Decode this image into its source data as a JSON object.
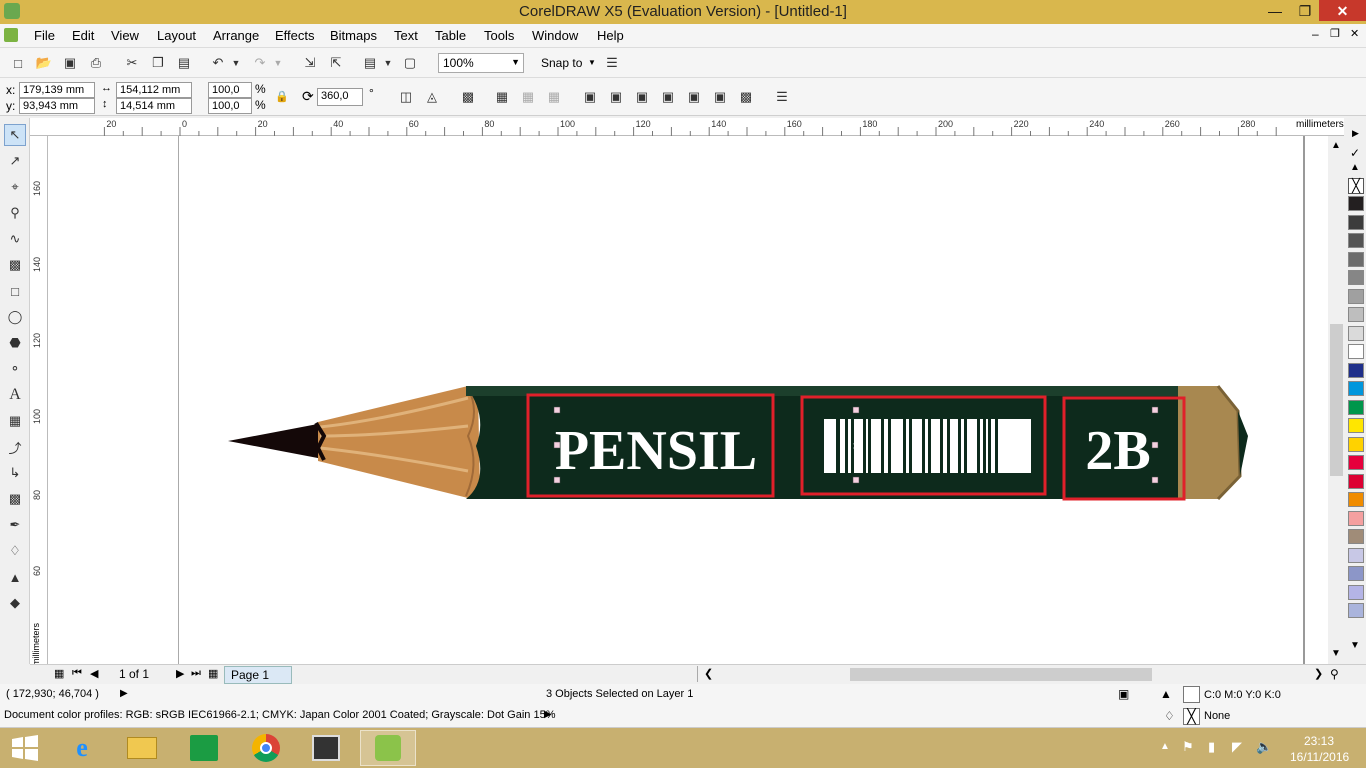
{
  "window": {
    "title": "CorelDRAW X5 (Evaluation Version) - [Untitled-1]",
    "minimize": "—",
    "restore": "❐",
    "close": "✕",
    "doc_minimize": "–",
    "doc_restore": "❐",
    "doc_close": "✕"
  },
  "menu": [
    "File",
    "Edit",
    "View",
    "Layout",
    "Arrange",
    "Effects",
    "Bitmaps",
    "Text",
    "Table",
    "Tools",
    "Window",
    "Help"
  ],
  "toolbar": {
    "zoom": "100%",
    "snap_to": "Snap to"
  },
  "properties": {
    "x_label": "x:",
    "x_value": "179,139 mm",
    "y_label": "y:",
    "y_value": "93,943 mm",
    "width_value": "154,112 mm",
    "height_value": "14,514 mm",
    "scale_x": "100,0",
    "scale_y": "100,0",
    "percent": "%",
    "rotation": "360,0",
    "degree": "°"
  },
  "ruler": {
    "h_ticks": [
      "20",
      "0",
      "20",
      "40",
      "60",
      "80",
      "100",
      "120",
      "140",
      "160",
      "180",
      "200",
      "220",
      "240",
      "260",
      "280"
    ],
    "h_unit": "millimeters",
    "v_ticks": [
      "160",
      "140",
      "120",
      "100",
      "80",
      "60"
    ],
    "v_unit": "millimeters"
  },
  "drawing": {
    "label_pensil": "PENSIL",
    "label_2b": "2B",
    "body_color": "#0d2a1c",
    "wood_color": "#c88a4a",
    "lead_color": "#140808",
    "ferrule_color": "#a88850",
    "selection_color": "#e0202a"
  },
  "page_nav": {
    "page_count": "1 of 1",
    "page_tab": "Page 1"
  },
  "status": {
    "coords": "( 172,930; 46,704 )",
    "selection_info": "3 Objects Selected on Layer 1",
    "fill_info": "C:0 M:0 Y:0 K:0",
    "outline_info": "None",
    "color_profiles": "Document color profiles: RGB: sRGB IEC61966-2.1; CMYK: Japan Color 2001 Coated; Grayscale: Dot Gain 15%"
  },
  "palette": [
    "#231f20",
    "#3c3c3c",
    "#545454",
    "#6c6c6c",
    "#868686",
    "#a0a0a0",
    "#bebebe",
    "#dadada",
    "#ffffff",
    "#1f2f8a",
    "#0096dc",
    "#00964b",
    "#ffe600",
    "#ffd200",
    "#e6003c",
    "#dc0032",
    "#f08c00",
    "#f5a0a0",
    "#a08c78",
    "#c8c8e6",
    "#8c96c8",
    "#b4b4e6",
    "#aab4dc"
  ],
  "taskbar": {
    "time": "23:13",
    "date": "16/11/2016"
  }
}
